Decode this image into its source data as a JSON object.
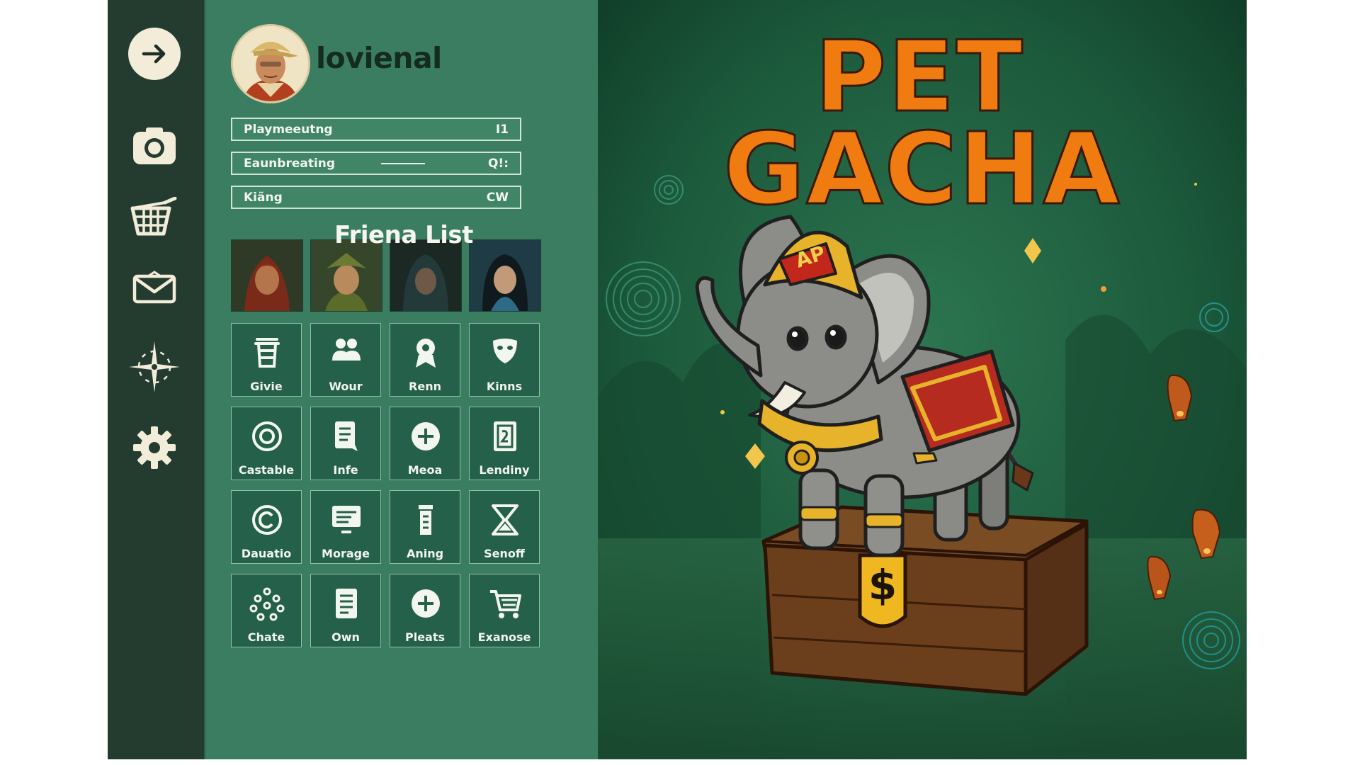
{
  "player": {
    "name": "lovienal"
  },
  "stats": [
    {
      "label": "Playmeeutng",
      "value": "I1"
    },
    {
      "label": "Eaunbreating",
      "value": "Q!:"
    },
    {
      "label": "Kiãng",
      "value": "CW"
    }
  ],
  "friends": {
    "title": "Friena List",
    "count": 4
  },
  "menu": [
    {
      "label": "Givie",
      "icon": "bucket-icon"
    },
    {
      "label": "Wour",
      "icon": "group-icon"
    },
    {
      "label": "Renn",
      "icon": "badge-icon"
    },
    {
      "label": "Kinns",
      "icon": "mask-icon"
    },
    {
      "label": "Castable",
      "icon": "target-icon"
    },
    {
      "label": "Infe",
      "icon": "document-icon"
    },
    {
      "label": "Meoa",
      "icon": "plus-circle-icon"
    },
    {
      "label": "Lendiny",
      "icon": "card-icon"
    },
    {
      "label": "Dauatio",
      "icon": "copyright-icon"
    },
    {
      "label": "Morage",
      "icon": "monitor-icon"
    },
    {
      "label": "Aning",
      "icon": "bottle-icon"
    },
    {
      "label": "Senoff",
      "icon": "hourglass-icon"
    },
    {
      "label": "Chate",
      "icon": "dots-cluster-icon"
    },
    {
      "label": "Own",
      "icon": "list-icon"
    },
    {
      "label": "Pleats",
      "icon": "plus-circle-icon"
    },
    {
      "label": "Exanose",
      "icon": "cart-icon"
    }
  ],
  "rail": [
    "arrow-right-icon",
    "camera-icon",
    "basket-icon",
    "mail-icon",
    "compass-icon",
    "gear-icon"
  ],
  "banner": {
    "title_line1": "PET",
    "title_line2": "GACHA",
    "hat_text": "AP",
    "chest_symbol": "$"
  },
  "colors": {
    "rail": "#243c30",
    "panel": "#3b7d61",
    "tile": "#25604a",
    "title": "#f07c11",
    "banner_bg": "#1d5a3c"
  }
}
